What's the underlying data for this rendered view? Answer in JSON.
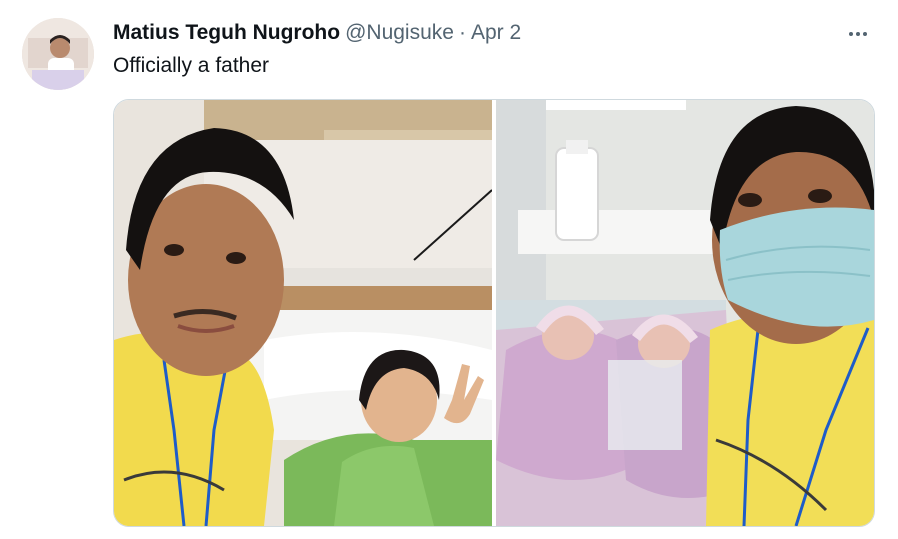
{
  "tweet": {
    "author_name": "Matius Teguh Nugroho",
    "handle": "@Nugisuke",
    "separator": "·",
    "date": "Apr 2",
    "text": "Officially a father"
  },
  "icons": {
    "more": "more-horizontal-icon"
  },
  "colors": {
    "text_primary": "#0f1419",
    "text_secondary": "#536471",
    "border": "#cfd9de"
  }
}
